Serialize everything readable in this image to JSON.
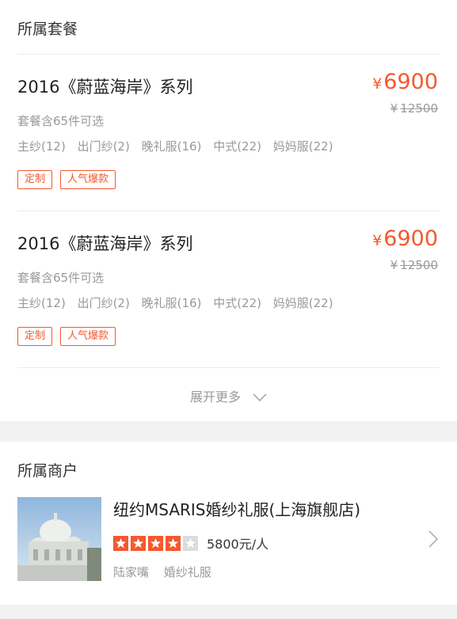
{
  "packages_section": {
    "title": "所属套餐",
    "items": [
      {
        "name": "2016《蔚蓝海岸》系列",
        "price_symbol": "¥",
        "price": "6900",
        "orig_symbol": "¥",
        "orig_price": "12500",
        "subtitle": "套餐含65件可选",
        "contents": [
          "主纱(12)",
          "出门纱(2)",
          "晚礼服(16)",
          "中式(22)",
          "妈妈服(22)"
        ],
        "tags": [
          "定制",
          "人气爆款"
        ]
      },
      {
        "name": "2016《蔚蓝海岸》系列",
        "price_symbol": "¥",
        "price": "6900",
        "orig_symbol": "¥",
        "orig_price": "12500",
        "subtitle": "套餐含65件可选",
        "contents": [
          "主纱(12)",
          "出门纱(2)",
          "晚礼服(16)",
          "中式(22)",
          "妈妈服(22)"
        ],
        "tags": [
          "定制",
          "人气爆款"
        ]
      }
    ],
    "expand_label": "展开更多",
    "expand_icon": "chevron-down-icon"
  },
  "merchant_section": {
    "title": "所属商户",
    "shop_name": "纽约MSARIS婚纱礼服(上海旗舰店)",
    "rating": 4,
    "rating_max": 5,
    "avg_price": "5800元/人",
    "district": "陆家嘴",
    "category": "婚纱礼服",
    "arrow_icon": "chevron-right-icon"
  },
  "colors": {
    "accent": "#f4592f",
    "muted_text": "#999999",
    "divider": "#ececec",
    "page_bg": "#f2f2f2"
  }
}
